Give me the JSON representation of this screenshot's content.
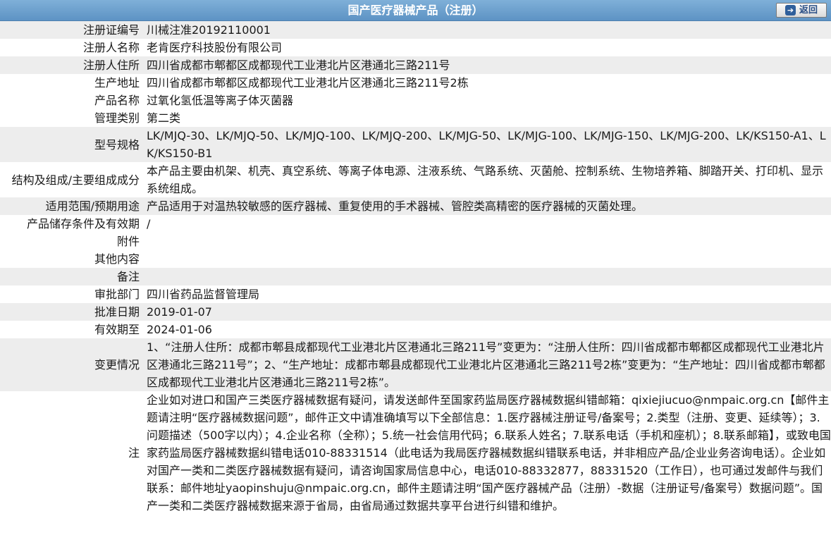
{
  "header": {
    "title": "国产医疗器械产品（注册）",
    "back_label": "返回"
  },
  "rows": [
    {
      "label": "注册证编号",
      "value": "川械注准20192110001"
    },
    {
      "label": "注册人名称",
      "value": "老肯医疗科技股份有限公司"
    },
    {
      "label": "注册人住所",
      "value": "四川省成都市郫都区成都现代工业港北片区港通北三路211号"
    },
    {
      "label": "生产地址",
      "value": "四川省成都市郫都区成都现代工业港北片区港通北三路211号2栋"
    },
    {
      "label": "产品名称",
      "value": "过氧化氢低温等离子体灭菌器"
    },
    {
      "label": "管理类别",
      "value": "第二类"
    },
    {
      "label": "型号规格",
      "value": "LK/MJQ-30、LK/MJQ-50、LK/MJQ-100、LK/MJQ-200、LK/MJG-50、LK/MJG-100、LK/MJG-150、LK/MJG-200、LK/KS150-A1、LK/KS150-B1"
    },
    {
      "label": "结构及组成/主要组成成分",
      "value": "本产品主要由机架、机壳、真空系统、等离子体电源、注液系统、气路系统、灭菌舱、控制系统、生物培养箱、脚踏开关、打印机、显示系统组成。"
    },
    {
      "label": "适用范围/预期用途",
      "value": "产品适用于对温热较敏感的医疗器械、重复使用的手术器械、管腔类高精密的医疗器械的灭菌处理。"
    },
    {
      "label": "产品储存条件及有效期",
      "value": "/"
    },
    {
      "label": "附件",
      "value": ""
    },
    {
      "label": "其他内容",
      "value": ""
    },
    {
      "label": "备注",
      "value": ""
    },
    {
      "label": "审批部门",
      "value": "四川省药品监督管理局"
    },
    {
      "label": "批准日期",
      "value": "2019-01-07"
    },
    {
      "label": "有效期至",
      "value": "2024-01-06"
    },
    {
      "label": "变更情况",
      "value": "1、“注册人住所：成都市郫县成都现代工业港北片区港通北三路211号”变更为：“注册人住所：四川省成都市郫都区成都现代工业港北片区港通北三路211号”；2、“生产地址：成都市郫县成都现代工业港北片区港通北三路211号2栋”变更为：“生产地址：四川省成都市郫都区成都现代工业港北片区港通北三路211号2栋”。"
    },
    {
      "label": "注",
      "value": "企业如对进口和国产三类医疗器械数据有疑问，请发送邮件至国家药监局医疗器械数据纠错邮箱：qixiejiucuo@nmpaic.org.cn【邮件主题请注明“医疗器械数据问题”，邮件正文中请准确填写以下全部信息：1.医疗器械注册证号/备案号；2.类型（注册、变更、延续等）；3.问题描述（500字以内）；4.企业名称（全称）；5.统一社会信用代码；6.联系人姓名；7.联系电话（手机和座机）；8.联系邮箱】，或致电国家药监局医疗器械数据纠错电话010-88331514（此电话为我局医疗器械数据纠错联系电话，并非相应产品/企业业务咨询电话）。企业如对国产一类和二类医疗器械数据有疑问，请咨询国家局信息中心，电话010-88332877，88331520（工作日），也可通过发邮件与我们联系：邮件地址yaopinshuju@nmpaic.org.cn，邮件主题请注明“国产医疗器械产品（注册）-数据（注册证号/备案号）数据问题”。国产一类和二类医疗器械数据来源于省局，由省局通过数据共享平台进行纠错和维护。"
    }
  ]
}
